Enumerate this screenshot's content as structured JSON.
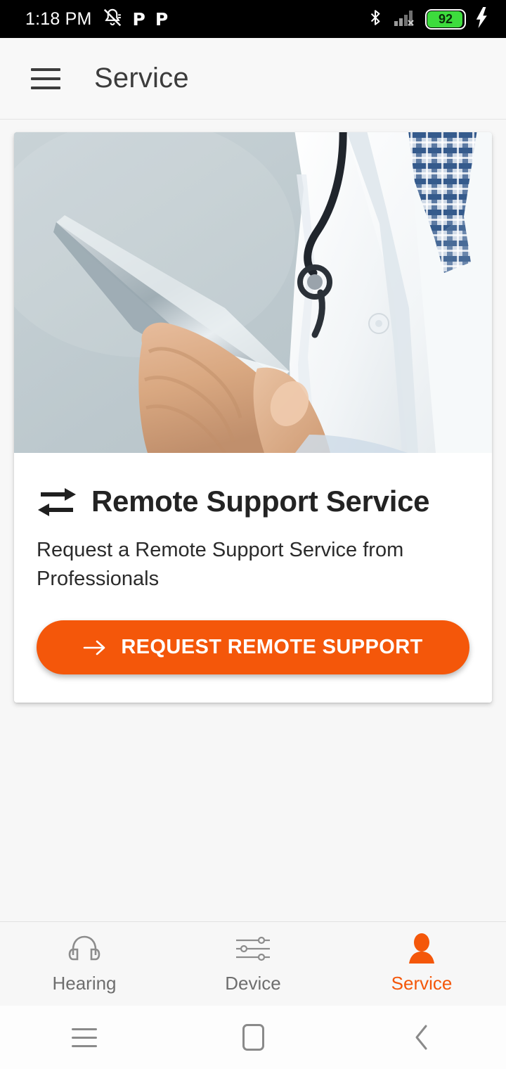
{
  "status_bar": {
    "time": "1:18 PM",
    "icons_left": [
      "notifications-off-icon",
      "p-app-icon",
      "p-app-icon"
    ],
    "icons_right": [
      "bluetooth-icon",
      "cellular-signal-off-icon",
      "battery-icon",
      "charging-bolt-icon"
    ],
    "battery_percent": "92",
    "battery_fill_color": "#3ddc3d"
  },
  "app_bar": {
    "menu_icon": "hamburger-menu-icon",
    "title": "Service"
  },
  "card": {
    "hero_image_alt": "doctor-with-tablet-photo",
    "title_icon": "compare-arrows-icon",
    "title": "Remote Support Service",
    "description": "Request a Remote Support Service from Professionals",
    "cta": {
      "icon": "arrow-right-icon",
      "label": "REQUEST REMOTE SUPPORT",
      "color": "#f4570a"
    }
  },
  "bottom_nav": {
    "active_color": "#f4570a",
    "inactive_color": "#6e6e6e",
    "items": [
      {
        "label": "Hearing",
        "icon": "headphones-icon",
        "active": false
      },
      {
        "label": "Device",
        "icon": "sliders-icon",
        "active": false
      },
      {
        "label": "Service",
        "icon": "person-icon",
        "active": true
      }
    ]
  },
  "android_nav": {
    "recents_icon": "recents-menu-icon",
    "home_icon": "home-square-icon",
    "back_icon": "back-chevron-icon"
  }
}
